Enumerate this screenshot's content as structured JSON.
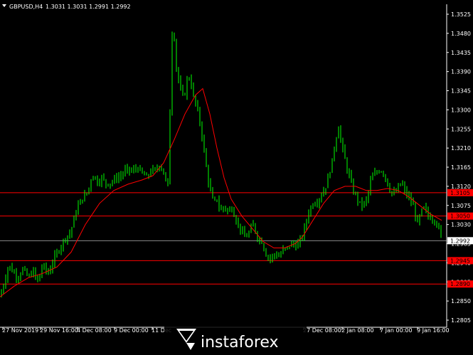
{
  "header": {
    "symbol_label": "GBPUSD,H4",
    "ohlc_values": "1.3031 1.3031 1.2991 1.2992"
  },
  "watermark": {
    "text": "instaforex"
  },
  "colors": {
    "background": "#000000",
    "grid": "#1a1a1a",
    "axis": "#ffffff",
    "candle": "#00ff00",
    "moving_average": "#ff0000",
    "level_line": "#ff0000",
    "current_price_line": "#8a8a8a"
  },
  "chart_data": {
    "type": "candlestick",
    "title": "GBPUSD,H4",
    "xlabel": "",
    "ylabel": "",
    "ylim": [
      1.2805,
      1.3525
    ],
    "grid": false,
    "y_ticks": [
      "1.3525",
      "1.3480",
      "1.3435",
      "1.3390",
      "1.3345",
      "1.3300",
      "1.3255",
      "1.3210",
      "1.3165",
      "1.3120",
      "1.3075",
      "1.3030",
      "1.2985",
      "1.2940",
      "1.2895",
      "1.2850",
      "1.2805"
    ],
    "x_ticks": [
      "27 Nov 2019",
      "29 Nov 16:00",
      "4 Dec 08:00",
      "9 Dec 00:00",
      "11 Dec",
      "27 Dec 08:00",
      "2 Jan 08:00",
      "7 Jan 00:00",
      "9 Jan 16:00"
    ],
    "horizontal_levels": [
      {
        "label": "1.3105",
        "value": 1.3105
      },
      {
        "label": "1.3050",
        "value": 1.305
      },
      {
        "label": "1.2945",
        "value": 1.2945
      },
      {
        "label": "1.2890",
        "value": 1.289
      }
    ],
    "current_price": {
      "label": "1.2992",
      "value": 1.2992
    },
    "close_path": [
      [
        0,
        1.286
      ],
      [
        7,
        1.29
      ],
      [
        12,
        1.2935
      ],
      [
        18,
        1.292
      ],
      [
        25,
        1.2905
      ],
      [
        32,
        1.2925
      ],
      [
        40,
        1.2905
      ],
      [
        47,
        1.292
      ],
      [
        53,
        1.2895
      ],
      [
        60,
        1.2935
      ],
      [
        68,
        1.2915
      ],
      [
        76,
        1.295
      ],
      [
        84,
        1.2975
      ],
      [
        92,
        1.3
      ],
      [
        99,
        1.301
      ],
      [
        105,
        1.305
      ],
      [
        111,
        1.308
      ],
      [
        118,
        1.3095
      ],
      [
        124,
        1.311
      ],
      [
        130,
        1.315
      ],
      [
        137,
        1.313
      ],
      [
        143,
        1.314
      ],
      [
        150,
        1.3125
      ],
      [
        157,
        1.313
      ],
      [
        164,
        1.314
      ],
      [
        170,
        1.3145
      ],
      [
        178,
        1.316
      ],
      [
        186,
        1.3155
      ],
      [
        193,
        1.3165
      ],
      [
        200,
        1.315
      ],
      [
        207,
        1.314
      ],
      [
        213,
        1.316
      ],
      [
        219,
        1.3155
      ],
      [
        225,
        1.3175
      ],
      [
        231,
        1.3145
      ],
      [
        236,
        1.312
      ],
      [
        239,
        1.33
      ],
      [
        242,
        1.348
      ],
      [
        245,
        1.347
      ],
      [
        248,
        1.34
      ],
      [
        252,
        1.336
      ],
      [
        256,
        1.333
      ],
      [
        260,
        1.334
      ],
      [
        264,
        1.338
      ],
      [
        268,
        1.337
      ],
      [
        272,
        1.333
      ],
      [
        276,
        1.331
      ],
      [
        280,
        1.328
      ],
      [
        284,
        1.324
      ],
      [
        288,
        1.319
      ],
      [
        292,
        1.314
      ],
      [
        296,
        1.311
      ],
      [
        300,
        1.308
      ],
      [
        305,
        1.309
      ],
      [
        310,
        1.306
      ],
      [
        315,
        1.3075
      ],
      [
        320,
        1.306
      ],
      [
        326,
        1.307
      ],
      [
        332,
        1.304
      ],
      [
        338,
        1.302
      ],
      [
        344,
        1.3
      ],
      [
        350,
        1.301
      ],
      [
        356,
        1.303
      ],
      [
        362,
        1.3
      ],
      [
        368,
        1.299
      ],
      [
        374,
        1.296
      ],
      [
        380,
        1.295
      ],
      [
        386,
        1.296
      ],
      [
        392,
        1.2955
      ],
      [
        398,
        1.297
      ],
      [
        404,
        1.2975
      ],
      [
        410,
        1.2985
      ],
      [
        416,
        1.298
      ],
      [
        422,
        1.299
      ],
      [
        428,
        1.302
      ],
      [
        434,
        1.306
      ],
      [
        440,
        1.308
      ],
      [
        446,
        1.3085
      ],
      [
        452,
        1.31
      ],
      [
        458,
        1.312
      ],
      [
        463,
        1.315
      ],
      [
        467,
        1.318
      ],
      [
        472,
        1.323
      ],
      [
        476,
        1.326
      ],
      [
        480,
        1.322
      ],
      [
        484,
        1.319
      ],
      [
        488,
        1.316
      ],
      [
        492,
        1.314
      ],
      [
        496,
        1.311
      ],
      [
        500,
        1.31
      ],
      [
        505,
        1.308
      ],
      [
        510,
        1.3075
      ],
      [
        516,
        1.309
      ],
      [
        522,
        1.314
      ],
      [
        528,
        1.315
      ],
      [
        534,
        1.316
      ],
      [
        540,
        1.315
      ],
      [
        546,
        1.312
      ],
      [
        552,
        1.31
      ],
      [
        558,
        1.311
      ],
      [
        564,
        1.313
      ],
      [
        570,
        1.3105
      ],
      [
        576,
        1.309
      ],
      [
        582,
        1.307
      ],
      [
        587,
        1.303
      ],
      [
        592,
        1.306
      ],
      [
        597,
        1.307
      ],
      [
        602,
        1.305
      ],
      [
        607,
        1.3045
      ],
      [
        612,
        1.304
      ],
      [
        617,
        1.302
      ],
      [
        621,
        1.2992
      ]
    ],
    "moving_average": [
      [
        0,
        1.286
      ],
      [
        20,
        1.2885
      ],
      [
        40,
        1.2905
      ],
      [
        60,
        1.2915
      ],
      [
        80,
        1.293
      ],
      [
        100,
        1.2965
      ],
      [
        120,
        1.303
      ],
      [
        140,
        1.308
      ],
      [
        160,
        1.311
      ],
      [
        180,
        1.3125
      ],
      [
        200,
        1.3135
      ],
      [
        215,
        1.3145
      ],
      [
        230,
        1.3175
      ],
      [
        245,
        1.323
      ],
      [
        260,
        1.329
      ],
      [
        275,
        1.3335
      ],
      [
        285,
        1.335
      ],
      [
        295,
        1.329
      ],
      [
        305,
        1.321
      ],
      [
        315,
        1.314
      ],
      [
        325,
        1.309
      ],
      [
        340,
        1.305
      ],
      [
        355,
        1.302
      ],
      [
        370,
        1.299
      ],
      [
        385,
        1.2975
      ],
      [
        400,
        1.2975
      ],
      [
        415,
        1.2985
      ],
      [
        425,
        1.3
      ],
      [
        440,
        1.304
      ],
      [
        455,
        1.308
      ],
      [
        470,
        1.311
      ],
      [
        485,
        1.312
      ],
      [
        500,
        1.312
      ],
      [
        515,
        1.311
      ],
      [
        530,
        1.311
      ],
      [
        545,
        1.3115
      ],
      [
        560,
        1.311
      ],
      [
        575,
        1.3095
      ],
      [
        590,
        1.3075
      ],
      [
        605,
        1.3055
      ],
      [
        621,
        1.304
      ]
    ]
  }
}
